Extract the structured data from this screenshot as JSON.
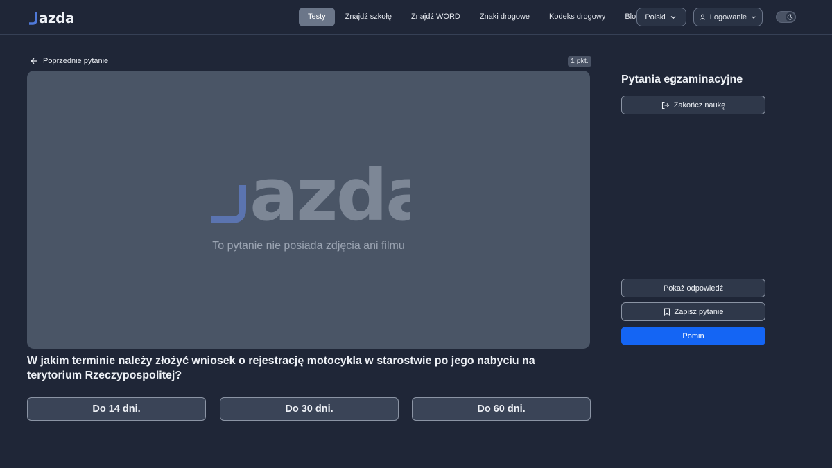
{
  "brand": {
    "logo_text": "azda",
    "logo_accent": "#4f79d9"
  },
  "nav": {
    "items": [
      "Testy",
      "Znajdź szkołę",
      "Znajdź WORD",
      "Znaki drogowe",
      "Kodeks drogowy",
      "Blog"
    ],
    "active": "Testy"
  },
  "header": {
    "language": "Polski",
    "login": "Logowanie",
    "theme_toggle_icon": "moon-icon"
  },
  "question_nav": {
    "previous_label": "Poprzednie pytanie",
    "points": "1 pkt."
  },
  "media": {
    "logo_text": "azda",
    "placeholder_text": "To pytanie nie posiada zdjęcia ani filmu"
  },
  "question": {
    "text": "W jakim terminie należy złożyć wniosek o rejestrację motocykla w starostwie po jego nabyciu na terytorium Rzeczypospolitej?",
    "answers": [
      "Do 14 dni.",
      "Do 30 dni.",
      "Do 60 dni."
    ]
  },
  "sidebar": {
    "title": "Pytania egzaminacyjne",
    "end_label": "Zakończ naukę",
    "show_answer_label": "Pokaż odpowiedź",
    "save_label": "Zapisz pytanie",
    "skip_label": "Pomiń"
  },
  "colors": {
    "background": "#1f2637",
    "primary": "#1465f4",
    "card": "#4a5566"
  }
}
